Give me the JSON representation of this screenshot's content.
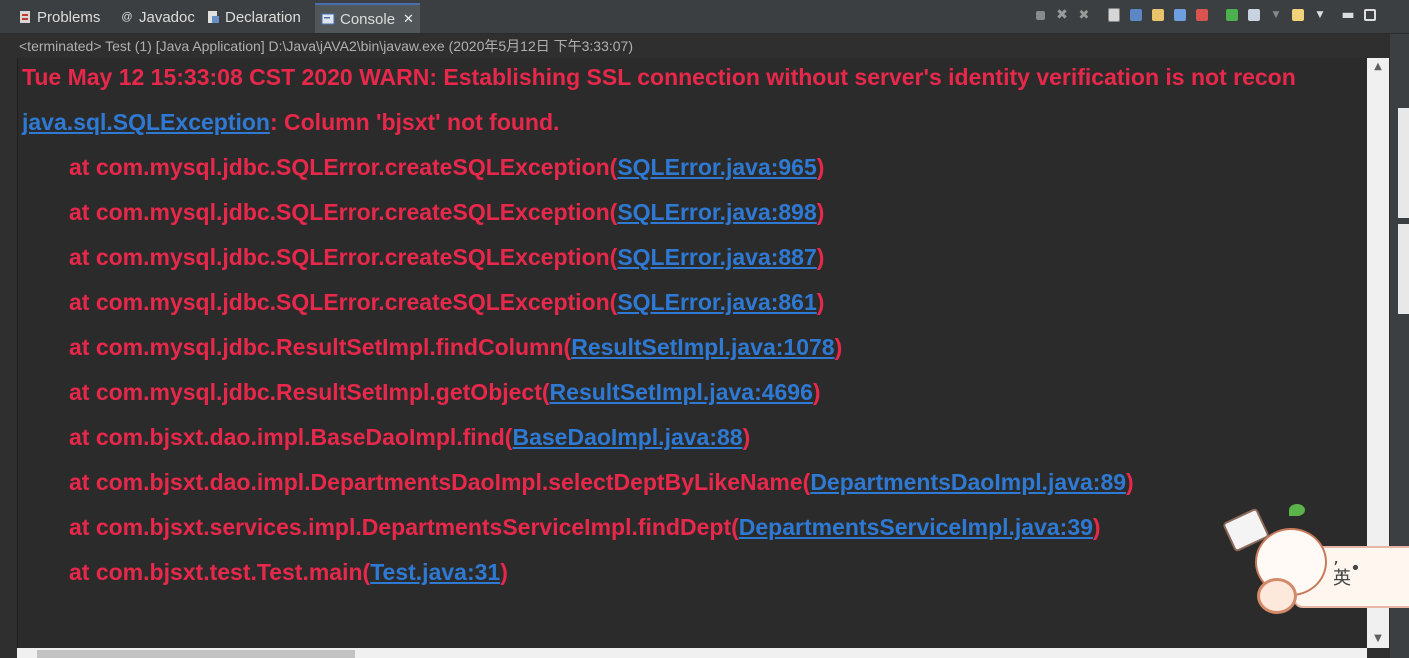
{
  "tabs": [
    {
      "label": "Problems",
      "icon": "problems-icon"
    },
    {
      "label": "Javadoc",
      "icon": "javadoc-icon"
    },
    {
      "label": "Declaration",
      "icon": "declaration-icon"
    },
    {
      "label": "Console",
      "icon": "console-icon",
      "active": true
    }
  ],
  "status_line": "<terminated> Test (1) [Java Application] D:\\Java\\jAVA2\\bin\\javaw.exe (2020年5月12日 下午3:33:07)",
  "console": {
    "warn_line": "Tue May 12 15:33:08 CST 2020 WARN: Establishing SSL connection without server's identity verification is not recon",
    "exception": {
      "link": "java.sql.SQLException",
      "message": ": Column 'bjsxt' not found."
    },
    "stack": [
      {
        "prefix": "at com.mysql.jdbc.SQLError.createSQLException(",
        "link": "SQLError.java:965",
        "suffix": ")"
      },
      {
        "prefix": "at com.mysql.jdbc.SQLError.createSQLException(",
        "link": "SQLError.java:898",
        "suffix": ")"
      },
      {
        "prefix": "at com.mysql.jdbc.SQLError.createSQLException(",
        "link": "SQLError.java:887",
        "suffix": ")"
      },
      {
        "prefix": "at com.mysql.jdbc.SQLError.createSQLException(",
        "link": "SQLError.java:861",
        "suffix": ")"
      },
      {
        "prefix": "at com.mysql.jdbc.ResultSetImpl.findColumn(",
        "link": "ResultSetImpl.java:1078",
        "suffix": ")"
      },
      {
        "prefix": "at com.mysql.jdbc.ResultSetImpl.getObject(",
        "link": "ResultSetImpl.java:4696",
        "suffix": ")"
      },
      {
        "prefix": "at com.bjsxt.dao.impl.BaseDaoImpl.find(",
        "link": "BaseDaoImpl.java:88",
        "suffix": ")"
      },
      {
        "prefix": "at com.bjsxt.dao.impl.DepartmentsDaoImpl.selectDeptByLikeName(",
        "link": "DepartmentsDaoImpl.java:89",
        "suffix": ")"
      },
      {
        "prefix": "at com.bjsxt.services.impl.DepartmentsServiceImpl.findDept(",
        "link": "DepartmentsServiceImpl.java:39",
        "suffix": ")"
      },
      {
        "prefix": "at com.bjsxt.test.Test.main(",
        "link": "Test.java:31",
        "suffix": ")"
      }
    ]
  },
  "ime_sticker": {
    "label": "英",
    "punct": "’, •"
  },
  "colors": {
    "error": "#e8284a",
    "link": "#2e79d3",
    "background": "#2b2b2b"
  }
}
